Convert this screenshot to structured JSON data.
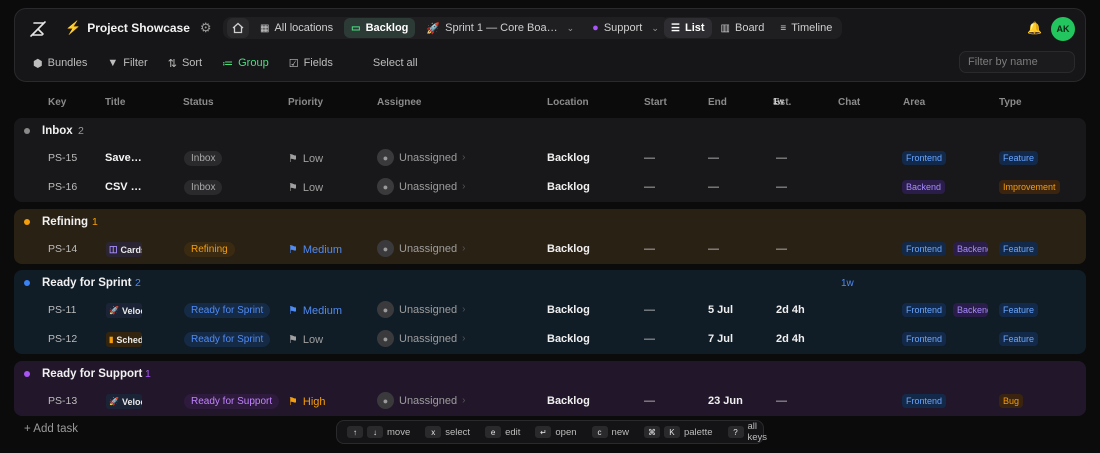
{
  "header": {
    "project_title": "Project Showcase",
    "nav": {
      "all_locations": "All locations",
      "backlog": "Backlog",
      "sprint": "Sprint 1 — Core Boa…",
      "support": "Support"
    },
    "views": {
      "list": "List",
      "board": "Board",
      "timeline": "Timeline"
    },
    "avatar": "AK"
  },
  "toolbar": {
    "bundles": "Bundles",
    "filter": "Filter",
    "sort": "Sort",
    "group": "Group",
    "fields": "Fields",
    "select_all": "Select all",
    "search_placeholder": "Filter by name"
  },
  "columns": {
    "key": "Key",
    "title": "Title",
    "status": "Status",
    "priority": "Priority",
    "assignee": "Assignee",
    "location": "Location",
    "start": "Start",
    "end": "End",
    "est": "Est.",
    "est_unit": "1w",
    "chat": "Chat",
    "area": "Area",
    "type": "Type"
  },
  "colors": {
    "inbox": "#8a8a8a",
    "refining": "#f59e0b",
    "ready": "#3b82f6",
    "support": "#a855f7",
    "accent_green": "#22c55e"
  },
  "groups": [
    {
      "name": "Inbox",
      "count": "2",
      "est": "",
      "tasks": [
        {
          "key": "PS-15",
          "title": "Save…",
          "status": "Inbox",
          "priority": "Low",
          "assignee": "Unassigned",
          "location": "Backlog",
          "start": "—",
          "end": "—",
          "est": "—",
          "area": [
            "Frontend"
          ],
          "type": "Feature"
        },
        {
          "key": "PS-16",
          "title": "CSV …",
          "status": "Inbox",
          "priority": "Low",
          "assignee": "Unassigned",
          "location": "Backlog",
          "start": "—",
          "end": "—",
          "est": "—",
          "area": [
            "Backend"
          ],
          "type": "Improvement"
        }
      ]
    },
    {
      "name": "Refining",
      "count": "1",
      "est": "",
      "tasks": [
        {
          "key": "PS-14",
          "bundle": "Cards",
          "status": "Refining",
          "priority": "Medium",
          "assignee": "Unassigned",
          "location": "Backlog",
          "start": "—",
          "end": "—",
          "est": "—",
          "area": [
            "Frontend",
            "Backend"
          ],
          "type": "Feature"
        }
      ]
    },
    {
      "name": "Ready for Sprint",
      "count": "2",
      "est": "1w",
      "tasks": [
        {
          "key": "PS-11",
          "bundle": "Veloci",
          "status": "Ready for Sprint",
          "priority": "Medium",
          "assignee": "Unassigned",
          "location": "Backlog",
          "start": "—",
          "end": "5 Jul",
          "est": "2d 4h",
          "area": [
            "Frontend",
            "Backend"
          ],
          "type": "Feature"
        },
        {
          "key": "PS-12",
          "bundle": "Sched",
          "status": "Ready for Sprint",
          "priority": "Low",
          "assignee": "Unassigned",
          "location": "Backlog",
          "start": "—",
          "end": "7 Jul",
          "est": "2d 4h",
          "area": [
            "Frontend"
          ],
          "type": "Feature"
        }
      ]
    },
    {
      "name": "Ready for Support",
      "count": "1",
      "est": "",
      "tasks": [
        {
          "key": "PS-13",
          "bundle": "Veloci",
          "status": "Ready for Support",
          "priority": "High",
          "assignee": "Unassigned",
          "location": "Backlog",
          "start": "—",
          "end": "23 Jun",
          "est": "—",
          "area": [
            "Frontend"
          ],
          "type": "Bug"
        }
      ]
    }
  ],
  "footer": {
    "add_task": "+ Add task",
    "shortcuts": {
      "move": "move",
      "select": "select",
      "edit": "edit",
      "open": "open",
      "new": "new",
      "palette": "palette",
      "all_keys": "all keys"
    }
  }
}
